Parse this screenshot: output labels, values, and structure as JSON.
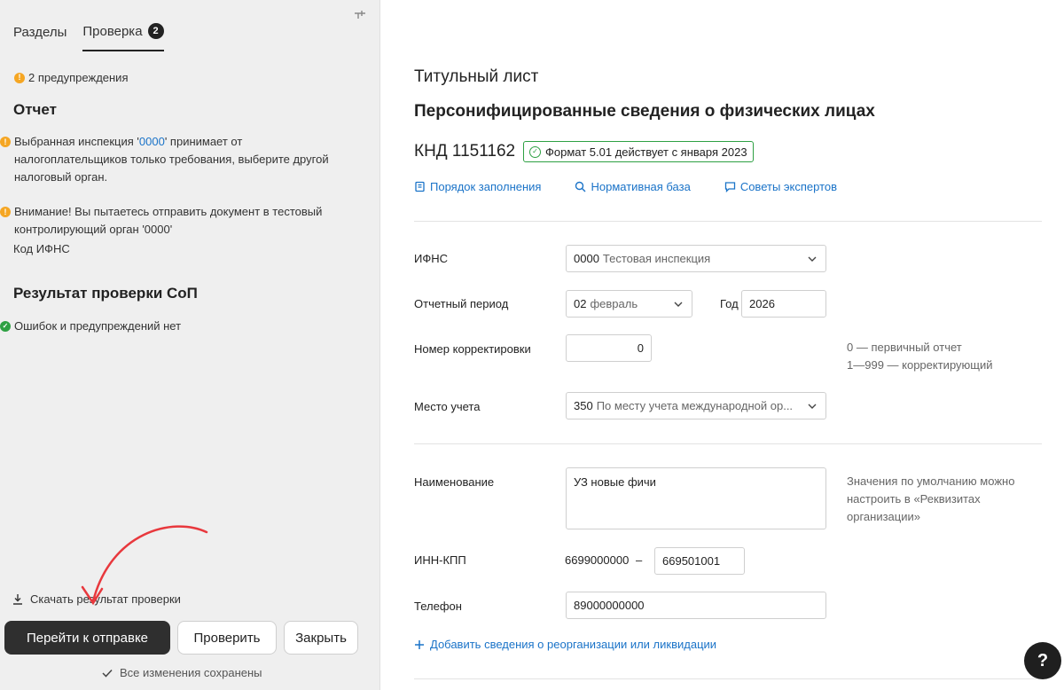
{
  "left_panel": {
    "tabs": [
      {
        "label": "Разделы"
      },
      {
        "label": "Проверка",
        "badge": "2"
      }
    ],
    "summary": "2 предупреждения",
    "report_heading": "Отчет",
    "warning1": {
      "pre": "Выбранная инспекция '",
      "link": "0000",
      "post": "' принимает от налогоплательщиков только требования, выберите другой налоговый орган."
    },
    "warning2": "Внимание! Вы пытаетесь отправить документ в тестовый контролирующий орган '0000'",
    "code_label": "Код ИФНС",
    "result_heading": "Результат проверки СоП",
    "result_ok": "Ошибок и предупреждений нет",
    "download_label": "Скачать результат проверки",
    "buttons": {
      "send": "Перейти к отправке",
      "check": "Проверить",
      "close": "Закрыть"
    },
    "saved_label": "Все изменения сохранены"
  },
  "right_panel": {
    "subtitle": "Титульный лист",
    "title": "Персонифицированные сведения о физических лицах",
    "knd": "КНД 1151162",
    "format_badge": "Формат 5.01 действует с января 2023",
    "links": {
      "fill_order": "Порядок заполнения",
      "normative": "Нормативная база",
      "experts": "Советы экспертов"
    },
    "form": {
      "ifns": {
        "label": "ИФНС",
        "code": "0000",
        "name": "Тестовая инспекция"
      },
      "period": {
        "label": "Отчетный период",
        "code": "02",
        "name": "февраль"
      },
      "year": {
        "label": "Год",
        "value": "2026"
      },
      "correction": {
        "label": "Номер корректировки",
        "value": "0",
        "hint1": "0 — первичный отчет",
        "hint2": "1—999 — корректирующий"
      },
      "place": {
        "label": "Место учета",
        "code": "350",
        "name": "По месту учета международной ор..."
      },
      "name": {
        "label": "Наименование",
        "value": "УЗ новые фичи",
        "hint": "Значения по умолчанию можно настроить в «Реквизитах организации»"
      },
      "inn_kpp": {
        "label": "ИНН-КПП",
        "inn": "6699000000",
        "separator": "–",
        "kpp": "669501001"
      },
      "phone": {
        "label": "Телефон",
        "value": "89000000000"
      }
    },
    "add_link": "Добавить сведения о реорганизации или ликвидации",
    "help_label": "?"
  },
  "colors": {
    "accent_link": "#1a73c8",
    "warning": "#f5a623",
    "success": "#2ea043",
    "primary_button": "#2f2f2f",
    "annotation_arrow": "#e8383d"
  },
  "icons": [
    "pin-icon",
    "warning-icon",
    "success-icon",
    "download-icon",
    "check-icon",
    "book-icon",
    "search-icon",
    "chat-icon",
    "chevron-down-icon",
    "plus-icon",
    "help-icon"
  ]
}
